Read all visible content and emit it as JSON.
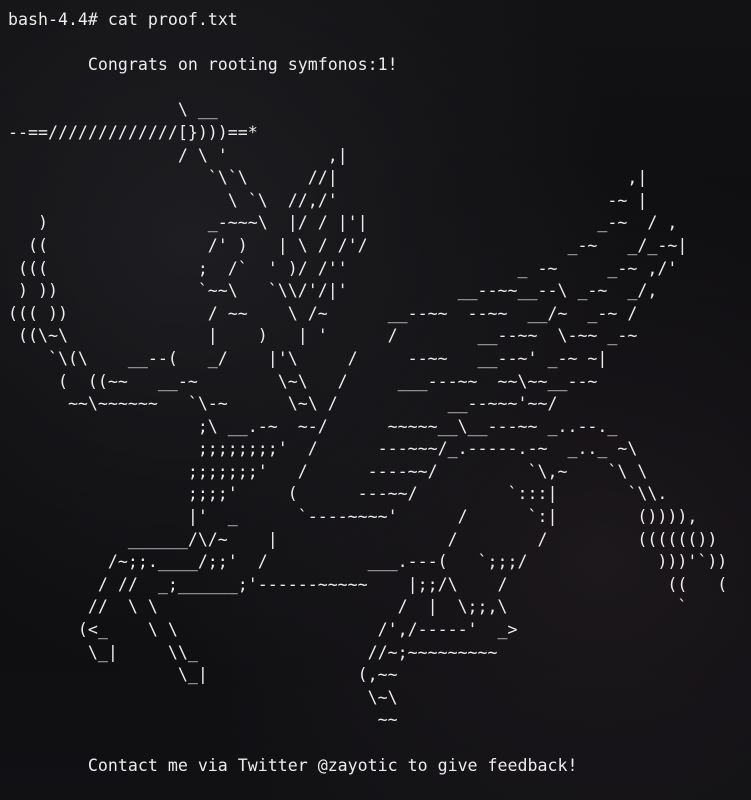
{
  "terminal": {
    "prompt": "bash-4.4#",
    "command": "cat proof.txt",
    "output_lines": [
      "",
      "        Congrats on rooting symfonos:1!",
      "",
      "                 \\ __",
      "--==/////////////[})))==*",
      "                 / \\ '          ,|",
      "                    `\\`\\      //|                             ,|",
      "                      \\ `\\  //,/'                           -~ |",
      "   )                _-~~~\\  |/ / |'|                       _-~  / ,",
      "  ((                /' )   | \\ / /'/                    _-~   _/_-~|",
      " (((               ;  /`  ' )/ /''                 _ -~     _-~ ,/'",
      " ) ))              `~~\\   `\\\\/'/|'           __--~~__--\\ _-~  _/,",
      "((( ))              / ~~    \\ /~      __--~~  --~~  __/~  _-~ /",
      " ((\\~\\              |    )   | '      /        __--~~  \\-~~ _-~",
      "    `\\(\\    __--(   _/    |'\\     /     --~~   __--~' _-~ ~|",
      "     (  ((~~   __-~        \\~\\   /     ___---~~  ~~\\~~__--~",
      "      ~~\\~~~~~~   `\\-~      \\~\\ /           __--~~~'~~/",
      "                   ;\\ __.-~  ~-/      ~~~~~__\\__---~~ _..--._",
      "                   ;;;;;;;;'  /      ---~~~/_.-----.-~  _.._ ~\\",
      "                  ;;;;;;;'   /      ----~~/         `\\,~    `\\ \\",
      "                  ;;;;'     (      ---~~/         `:::|       `\\\\.",
      "                  |'  _      `----~~~~'      /      `:|        ()))),",
      "            ______/\\/~    |                 /        /         (((((())",
      "          /~;;.____/;;'  /          ___.---(   `;;;/             )))'`))",
      "         / //  _;______;'------~~~~~    |;;/\\    /                ((   (",
      "        //  \\ \\                        /  |  \\;;,\\                 `",
      "       (<_    \\ \\                    /',/-----'  _>",
      "        \\_|     \\\\_                 //~;~~~~~~~~~",
      "                 \\_|               (,~~",
      "                                    \\~\\",
      "                                     ~~",
      "",
      "        Contact me via Twitter @zayotic to give feedback!"
    ]
  }
}
